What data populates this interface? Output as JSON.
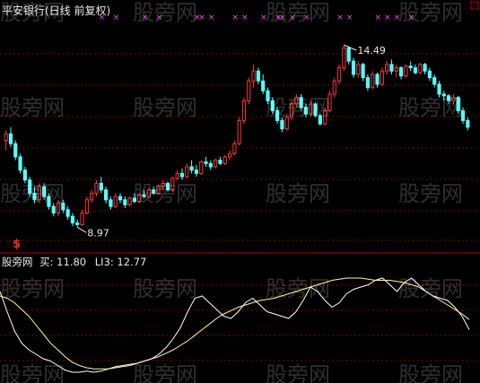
{
  "header": {
    "title": "平安银行(日线 前复权)"
  },
  "indicator": {
    "name": "股旁网",
    "buy": "买: 11.80",
    "li3": "LI3: 12.77"
  },
  "watermark": "股旁网",
  "colors": {
    "background": "#000000",
    "up": "#ff3232",
    "down": "#54ffff",
    "grid": "#8b0000",
    "line_white": "#ffffff",
    "line_yellow": "#ffff80",
    "x_mark": "#ff40ff",
    "label": "#e8e8e8"
  },
  "chart_data": {
    "type": "candlestick",
    "title": "平安银行(日线 前复权)",
    "high_label": "14.49",
    "low_label": "8.97",
    "buy_marker": "$",
    "price_range": [
      8.3,
      15.2
    ],
    "candles": [
      [
        11.6,
        11.9,
        11.3,
        11.8
      ],
      [
        11.8,
        12.0,
        11.4,
        11.5
      ],
      [
        11.5,
        11.6,
        11.0,
        11.1
      ],
      [
        11.1,
        11.2,
        10.6,
        10.7
      ],
      [
        10.7,
        10.8,
        10.3,
        10.4
      ],
      [
        10.4,
        10.5,
        9.9,
        10.0
      ],
      [
        10.0,
        10.2,
        9.7,
        9.8
      ],
      [
        9.8,
        10.3,
        9.7,
        10.2
      ],
      [
        10.2,
        10.3,
        9.8,
        9.9
      ],
      [
        9.9,
        10.0,
        9.5,
        9.6
      ],
      [
        9.6,
        9.7,
        9.3,
        9.4
      ],
      [
        9.4,
        9.8,
        9.3,
        9.7
      ],
      [
        9.7,
        9.8,
        9.4,
        9.5
      ],
      [
        9.5,
        9.6,
        9.2,
        9.3
      ],
      [
        9.3,
        9.4,
        9.0,
        9.1
      ],
      [
        9.1,
        9.2,
        8.97,
        9.05
      ],
      [
        9.05,
        9.5,
        9.0,
        9.4
      ],
      [
        9.4,
        9.9,
        9.35,
        9.8
      ],
      [
        9.8,
        10.1,
        9.7,
        10.0
      ],
      [
        10.0,
        10.4,
        9.9,
        10.3
      ],
      [
        10.3,
        10.5,
        10.0,
        10.1
      ],
      [
        10.1,
        10.2,
        9.7,
        9.8
      ],
      [
        9.8,
        9.9,
        9.5,
        9.6
      ],
      [
        9.6,
        10.0,
        9.55,
        9.9
      ],
      [
        9.9,
        10.0,
        9.7,
        9.8
      ],
      [
        9.8,
        9.9,
        9.55,
        9.65
      ],
      [
        9.65,
        9.9,
        9.6,
        9.85
      ],
      [
        9.85,
        10.0,
        9.7,
        9.75
      ],
      [
        9.75,
        10.0,
        9.7,
        9.95
      ],
      [
        9.95,
        10.1,
        9.85,
        9.9
      ],
      [
        9.9,
        10.15,
        9.85,
        10.1
      ],
      [
        10.1,
        10.2,
        9.95,
        10.0
      ],
      [
        10.0,
        10.25,
        9.95,
        10.2
      ],
      [
        10.2,
        10.4,
        10.1,
        10.3
      ],
      [
        10.3,
        10.35,
        10.05,
        10.1
      ],
      [
        10.1,
        10.5,
        10.05,
        10.45
      ],
      [
        10.45,
        10.7,
        10.4,
        10.6
      ],
      [
        10.6,
        10.75,
        10.4,
        10.5
      ],
      [
        10.5,
        10.9,
        10.45,
        10.8
      ],
      [
        10.8,
        11.0,
        10.6,
        10.7
      ],
      [
        10.7,
        10.85,
        10.5,
        10.6
      ],
      [
        10.6,
        11.0,
        10.55,
        10.95
      ],
      [
        10.95,
        11.1,
        10.8,
        10.9
      ],
      [
        10.9,
        11.0,
        10.7,
        10.8
      ],
      [
        10.8,
        11.05,
        10.75,
        11.0
      ],
      [
        11.0,
        11.1,
        10.85,
        10.9
      ],
      [
        10.9,
        11.15,
        10.85,
        11.1
      ],
      [
        11.1,
        11.3,
        11.0,
        11.2
      ],
      [
        11.2,
        11.6,
        11.15,
        11.5
      ],
      [
        11.5,
        12.3,
        11.45,
        12.2
      ],
      [
        12.2,
        12.9,
        12.1,
        12.8
      ],
      [
        12.8,
        13.5,
        12.7,
        13.4
      ],
      [
        13.4,
        13.9,
        13.2,
        13.7
      ],
      [
        13.7,
        13.8,
        13.3,
        13.4
      ],
      [
        13.4,
        13.6,
        13.0,
        13.1
      ],
      [
        13.1,
        13.2,
        12.7,
        12.8
      ],
      [
        12.8,
        12.9,
        12.4,
        12.5
      ],
      [
        12.5,
        12.6,
        12.1,
        12.2
      ],
      [
        12.2,
        12.3,
        11.85,
        11.95
      ],
      [
        11.95,
        12.4,
        11.9,
        12.3
      ],
      [
        12.3,
        12.8,
        12.2,
        12.7
      ],
      [
        12.7,
        13.0,
        12.6,
        12.9
      ],
      [
        12.9,
        13.0,
        12.5,
        12.6
      ],
      [
        12.6,
        12.7,
        12.3,
        12.4
      ],
      [
        12.4,
        12.8,
        12.35,
        12.7
      ],
      [
        12.7,
        12.75,
        12.3,
        12.35
      ],
      [
        12.35,
        12.4,
        12.05,
        12.1
      ],
      [
        12.1,
        12.6,
        12.05,
        12.5
      ],
      [
        12.5,
        13.1,
        12.45,
        13.0
      ],
      [
        13.0,
        13.5,
        12.9,
        13.4
      ],
      [
        13.4,
        13.9,
        13.3,
        13.8
      ],
      [
        13.8,
        14.49,
        13.7,
        14.4
      ],
      [
        14.4,
        14.45,
        13.9,
        14.0
      ],
      [
        14.0,
        14.1,
        13.5,
        13.6
      ],
      [
        13.6,
        14.0,
        13.5,
        13.9
      ],
      [
        13.9,
        13.95,
        13.4,
        13.5
      ],
      [
        13.5,
        13.6,
        13.1,
        13.2
      ],
      [
        13.2,
        13.7,
        13.15,
        13.6
      ],
      [
        13.6,
        13.65,
        13.2,
        13.3
      ],
      [
        13.3,
        13.8,
        13.25,
        13.7
      ],
      [
        13.7,
        14.0,
        13.6,
        13.9
      ],
      [
        13.9,
        14.05,
        13.6,
        13.7
      ],
      [
        13.7,
        13.9,
        13.5,
        13.8
      ],
      [
        13.8,
        13.85,
        13.45,
        13.55
      ],
      [
        13.55,
        13.9,
        13.5,
        13.85
      ],
      [
        13.85,
        14.0,
        13.7,
        13.8
      ],
      [
        13.8,
        13.9,
        13.6,
        13.65
      ],
      [
        13.65,
        13.95,
        13.6,
        13.9
      ],
      [
        13.9,
        13.95,
        13.6,
        13.7
      ],
      [
        13.7,
        13.8,
        13.4,
        13.5
      ],
      [
        13.5,
        13.6,
        13.2,
        13.3
      ],
      [
        13.3,
        13.4,
        12.9,
        13.0
      ],
      [
        13.0,
        13.1,
        12.8,
        12.95
      ],
      [
        12.95,
        13.0,
        12.7,
        12.8
      ],
      [
        12.8,
        13.0,
        12.7,
        12.9
      ],
      [
        12.9,
        12.95,
        12.4,
        12.5
      ],
      [
        12.5,
        12.6,
        12.1,
        12.2
      ],
      [
        12.2,
        12.3,
        11.9,
        12.0
      ]
    ],
    "x_marks": [
      20,
      23,
      29,
      32,
      40,
      41,
      43,
      48,
      50,
      54,
      57,
      58,
      60,
      63,
      70,
      72,
      78,
      80,
      82,
      85
    ],
    "subchart": {
      "range": [
        0,
        100
      ],
      "white_line": [
        80,
        62,
        45,
        34,
        28,
        24,
        20,
        18,
        14,
        10,
        8,
        8,
        9,
        8,
        9,
        11,
        13,
        14,
        15,
        16,
        18,
        20,
        24,
        30,
        38,
        48,
        62,
        74,
        76,
        70,
        64,
        58,
        56,
        62,
        70,
        74,
        68,
        62,
        60,
        58,
        56,
        62,
        72,
        84,
        80,
        72,
        66,
        70,
        78,
        82,
        84,
        86,
        90,
        92,
        86,
        80,
        88,
        92,
        86,
        80,
        76,
        74,
        72,
        66,
        58,
        46
      ],
      "yellow_line": [
        76,
        74,
        70,
        64,
        58,
        50,
        42,
        34,
        28,
        22,
        17,
        14,
        12,
        11,
        11,
        11,
        12,
        13,
        14,
        16,
        18,
        20,
        22,
        25,
        28,
        32,
        36,
        41,
        46,
        51,
        56,
        60,
        63,
        66,
        68,
        70,
        72,
        73,
        74,
        76,
        78,
        80,
        82,
        84,
        86,
        88,
        90,
        91,
        92,
        92,
        92,
        91,
        90,
        90,
        90,
        89,
        88,
        86,
        84,
        80,
        76,
        72,
        68,
        64,
        60,
        55
      ]
    }
  }
}
